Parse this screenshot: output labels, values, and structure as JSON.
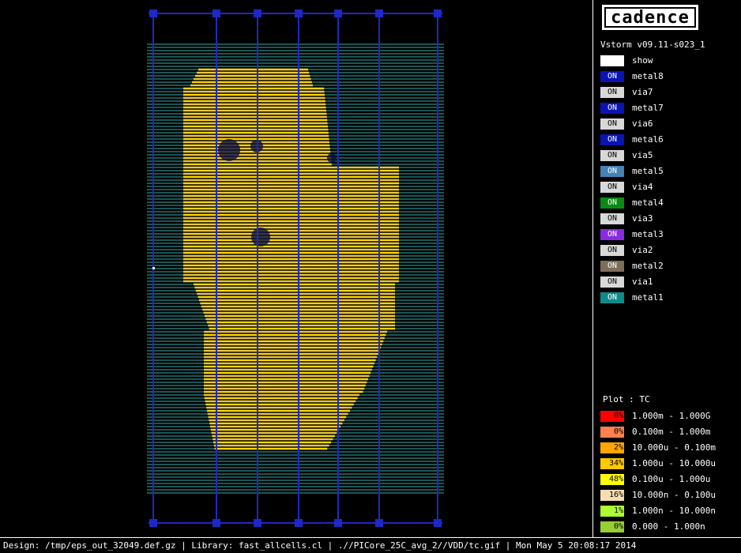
{
  "logo": {
    "text": "cadence"
  },
  "version": "Vstorm v09.11-s023_1",
  "layers": [
    {
      "chip": "",
      "name": "show",
      "color": "#ffffff"
    },
    {
      "chip": "ON",
      "name": "metal8",
      "color": "#0a14b4"
    },
    {
      "chip": "ON",
      "name": "via7",
      "color": "#d8d8d8"
    },
    {
      "chip": "ON",
      "name": "metal7",
      "color": "#0a14b4"
    },
    {
      "chip": "ON",
      "name": "via6",
      "color": "#d8d8d8"
    },
    {
      "chip": "ON",
      "name": "metal6",
      "color": "#0a14b4"
    },
    {
      "chip": "ON",
      "name": "via5",
      "color": "#d8d8d8"
    },
    {
      "chip": "ON",
      "name": "metal5",
      "color": "#4682b4"
    },
    {
      "chip": "ON",
      "name": "via4",
      "color": "#d8d8d8"
    },
    {
      "chip": "ON",
      "name": "metal4",
      "color": "#0a8a14"
    },
    {
      "chip": "ON",
      "name": "via3",
      "color": "#d8d8d8"
    },
    {
      "chip": "ON",
      "name": "metal3",
      "color": "#8a2be2"
    },
    {
      "chip": "ON",
      "name": "via2",
      "color": "#d8d8d8"
    },
    {
      "chip": "ON",
      "name": "metal2",
      "color": "#7d6e5a"
    },
    {
      "chip": "ON",
      "name": "via1",
      "color": "#d8d8d8"
    },
    {
      "chip": "ON",
      "name": "metal1",
      "color": "#0f8a8a"
    }
  ],
  "plot": {
    "title": "Plot : TC",
    "scale": [
      {
        "pct": "0%",
        "range": "1.000m - 1.000G",
        "color": "#ff0000"
      },
      {
        "pct": "0%",
        "range": "0.100m - 1.000m",
        "color": "#ff7f50"
      },
      {
        "pct": "2%",
        "range": "10.000u - 0.100m",
        "color": "#ffa500"
      },
      {
        "pct": "34%",
        "range": "1.000u - 10.000u",
        "color": "#ffc800"
      },
      {
        "pct": "48%",
        "range": "0.100u - 1.000u",
        "color": "#ffff00"
      },
      {
        "pct": "16%",
        "range": "10.000n - 0.100u",
        "color": "#f5deb3"
      },
      {
        "pct": "1%",
        "range": "1.000n - 10.000n",
        "color": "#adff2f"
      },
      {
        "pct": "0%",
        "range": "0.000 - 1.000n",
        "color": "#9acd32"
      }
    ]
  },
  "status": "Design: /tmp/eps_out_32049.def.gz | Library: fast_allcells.cl | .//PICore_25C_avg_2//VDD/tc.gif | Mon May  5 20:08:17 2014"
}
